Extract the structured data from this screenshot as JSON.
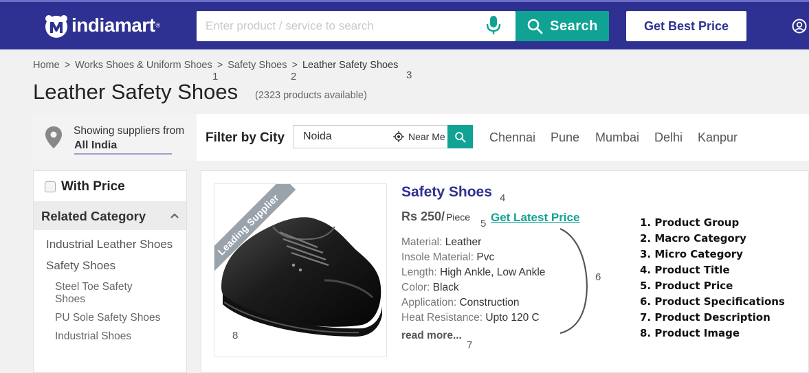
{
  "header": {
    "logo_text": "indiamart",
    "logo_reg": "®",
    "search_placeholder": "Enter product / service to search",
    "search_label": "Search",
    "best_price_label": "Get Best Price"
  },
  "breadcrumb": {
    "items": [
      "Home",
      "Works Shoes & Uniform Shoes",
      "Safety Shoes",
      "Leather Safety Shoes"
    ],
    "sep": ">"
  },
  "annotations": {
    "n1": "1",
    "n2": "2",
    "n3": "3",
    "n4": "4",
    "n5": "5",
    "n6": "6",
    "n7": "7",
    "n8": "8"
  },
  "page": {
    "title": "Leather Safety Shoes",
    "count": "(2323 products available)"
  },
  "filter": {
    "showing": "Showing suppliers from",
    "location": "All India",
    "label": "Filter by City",
    "city_value": "Noida",
    "near_me": "Near Me",
    "cities": [
      "Chennai",
      "Pune",
      "Mumbai",
      "Delhi",
      "Kanpur"
    ]
  },
  "sidebar": {
    "with_price": "With Price",
    "related_title": "Related Category",
    "categories": [
      "Industrial Leather Shoes",
      "Safety Shoes"
    ],
    "subcategories": [
      "Steel Toe Safety Shoes",
      "PU Sole Safety Shoes",
      "Industrial Shoes"
    ]
  },
  "product": {
    "ribbon": "Leading Supplier",
    "title": "Safety Shoes",
    "price": "Rs 250/",
    "unit": "Piece",
    "latest_price": "Get Latest Price",
    "specs": [
      {
        "k": "Material:",
        "v": "Leather"
      },
      {
        "k": "Insole Material:",
        "v": "Pvc"
      },
      {
        "k": "Length:",
        "v": "High Ankle, Low Ankle"
      },
      {
        "k": "Color:",
        "v": "Black"
      },
      {
        "k": "Application:",
        "v": "Construction"
      },
      {
        "k": "Heat Resistance:",
        "v": "Upto 120 C"
      }
    ],
    "read_more": "read more..."
  },
  "legend": [
    "1. Product Group",
    "2. Macro Category",
    "3. Micro Category",
    "4. Product Title",
    "5. Product Price",
    "6. Product Specifications",
    "7. Product Description",
    "8. Product Image"
  ],
  "colors": {
    "header": "#2e3192",
    "accent": "#10a394"
  }
}
